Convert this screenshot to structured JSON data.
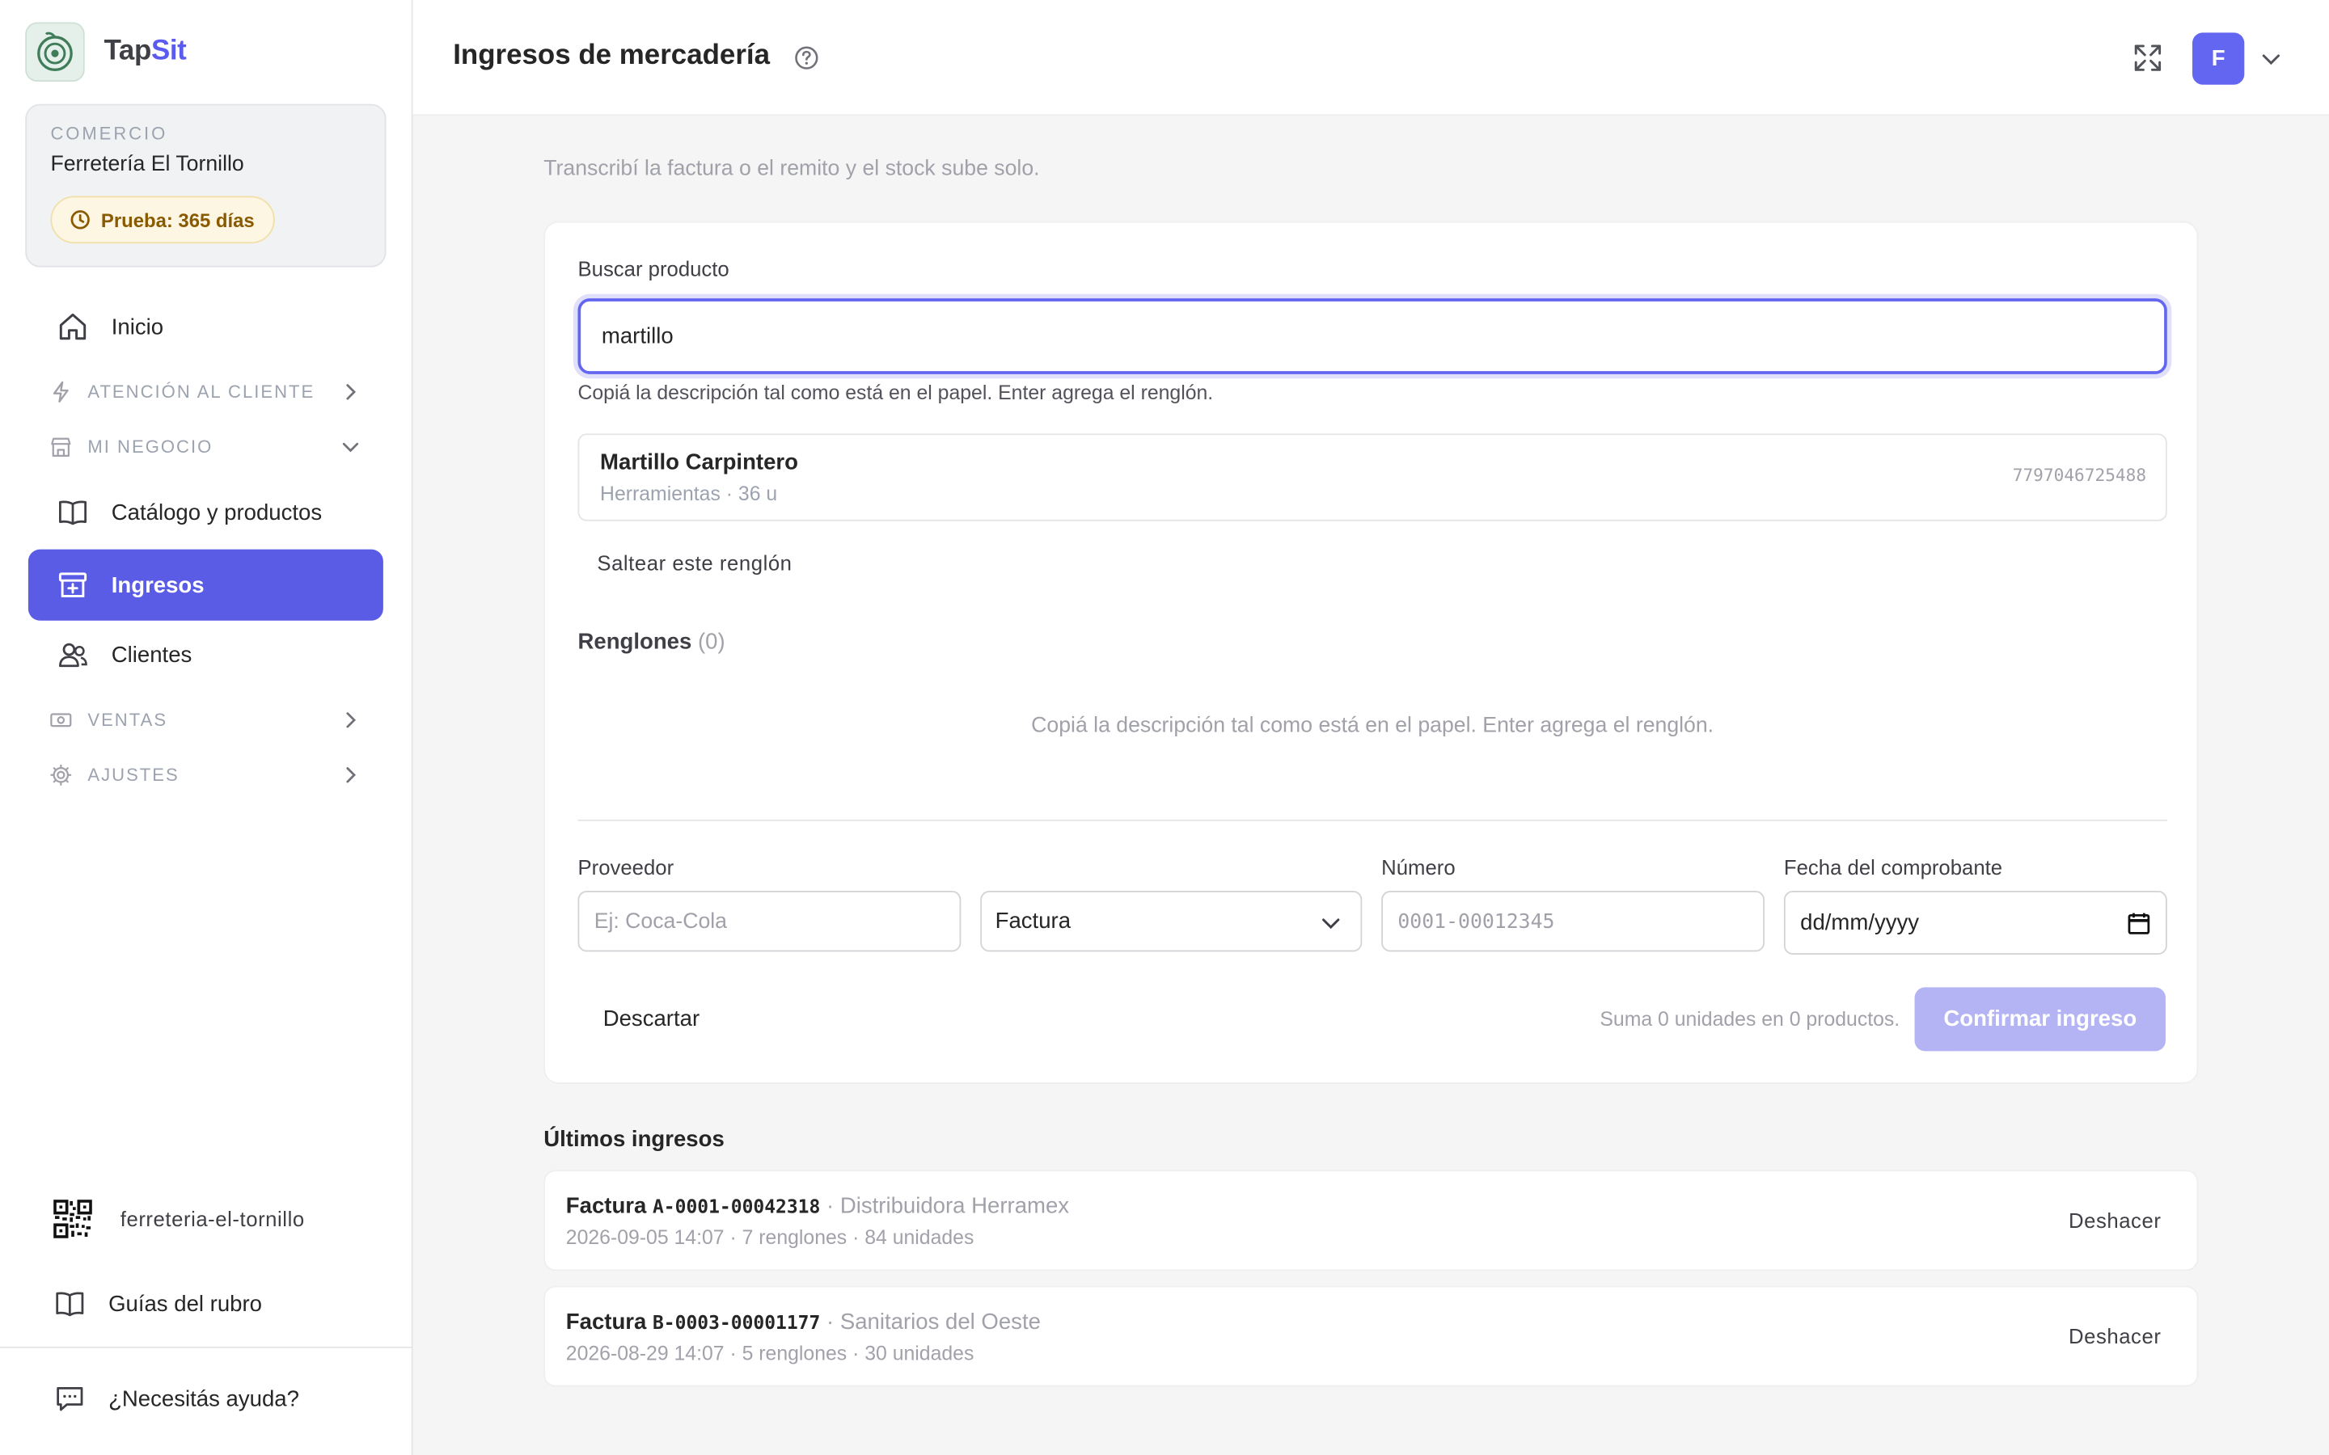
{
  "brand": {
    "name_a": "Tap",
    "name_b": "Sit",
    "accent_color": "#5b5bf0"
  },
  "store": {
    "kicker": "COMERCIO",
    "name": "Ferretería El Tornillo",
    "trial_label": "Prueba: 365 días"
  },
  "nav": {
    "home": "Inicio",
    "group_customer": "ATENCIÓN AL CLIENTE",
    "group_business": "MI NEGOCIO",
    "catalog": "Catálogo y productos",
    "ingresos": "Ingresos",
    "clients": "Clientes",
    "group_sales": "VENTAS",
    "group_settings": "AJUSTES",
    "qr_slug": "ferreteria-el-tornillo",
    "guides": "Guías del rubro",
    "help": "¿Necesitás ayuda?"
  },
  "header": {
    "title": "Ingresos de mercadería",
    "avatar_initial": "F"
  },
  "page": {
    "subtitle": "Transcribí la factura o el remito y el stock sube solo."
  },
  "search": {
    "label": "Buscar producto",
    "value": "martillo",
    "hint": "Copiá la descripción tal como está en el papel. Enter agrega el renglón."
  },
  "result": {
    "name": "Martillo Carpintero",
    "meta": "Herramientas · 36 u",
    "code": "7797046725488"
  },
  "skip_label": "Saltear este renglón",
  "lines": {
    "title": "Renglones",
    "count": "(0)",
    "empty": "Copiá la descripción tal como está en el papel. Enter agrega el renglón."
  },
  "form": {
    "supplier_label": "Proveedor",
    "supplier_placeholder": "Ej: Coca-Cola",
    "doc_type": "Factura",
    "number_label": "Número",
    "number_placeholder": "0001-00012345",
    "date_label": "Fecha del comprobante",
    "date_placeholder": "dd/mm/yyyy"
  },
  "actions": {
    "discard": "Descartar",
    "summary": "Suma 0 unidades en 0 productos.",
    "confirm": "Confirmar ingreso"
  },
  "recent": {
    "title": "Últimos ingresos",
    "items": [
      {
        "kind": "Factura",
        "number": "A-0001-00042318",
        "supplier": "· Distribuidora Herramex",
        "meta": "2026-09-05 14:07 · 7 renglones · 84 unidades",
        "undo": "Deshacer"
      },
      {
        "kind": "Factura",
        "number": "B-0003-00001177",
        "supplier": "· Sanitarios del Oeste",
        "meta": "2026-08-29 14:07 · 5 renglones · 30 unidades",
        "undo": "Deshacer"
      }
    ]
  }
}
